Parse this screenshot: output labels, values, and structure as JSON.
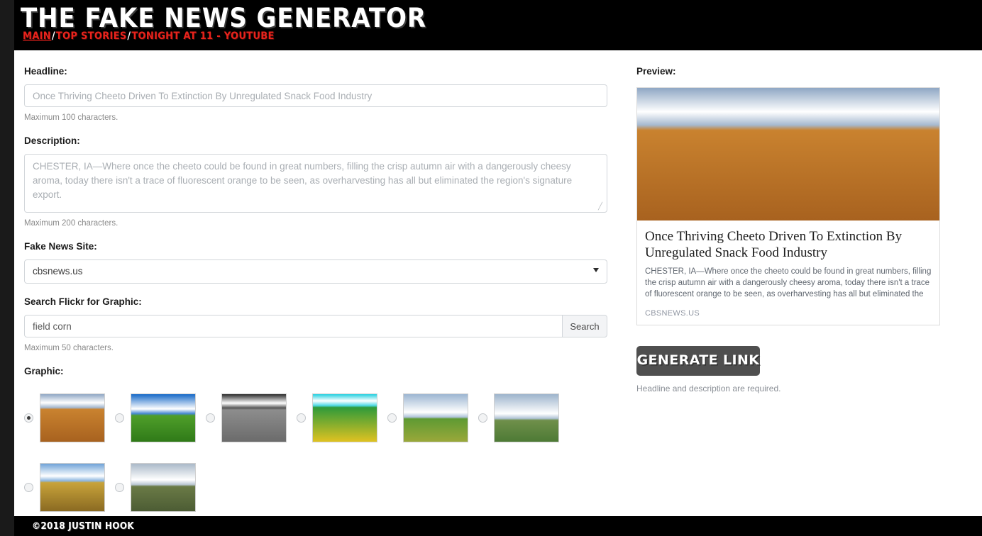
{
  "header": {
    "title": "THE FAKE NEWS GENERATOR",
    "nav": [
      {
        "label": "MAIN",
        "active": true
      },
      {
        "label": "TOP STORIES",
        "active": false
      },
      {
        "label": "TONIGHT AT 11 - YOUTUBE",
        "active": false
      }
    ],
    "separator": "/"
  },
  "form": {
    "headline": {
      "label": "Headline:",
      "value": "",
      "placeholder": "Once Thriving Cheeto Driven To Extinction By Unregulated Snack Food Industry",
      "help": "Maximum 100 characters."
    },
    "description": {
      "label": "Description:",
      "value": "",
      "placeholder": "CHESTER, IA—Where once the cheeto could be found in great numbers, filling the crisp autumn air with a dangerously cheesy aroma, today there isn't a trace of fluorescent orange to be seen, as overharvesting has all but eliminated the region's signature export.",
      "help": "Maximum 200 characters."
    },
    "site": {
      "label": "Fake News Site:",
      "selected": "cbsnews.us",
      "options": [
        "cbsnews.us"
      ]
    },
    "flickr": {
      "label": "Search Flickr for Graphic:",
      "value": "field corn",
      "placeholder": "",
      "button_label": "Search",
      "help": "Maximum 50 characters."
    },
    "graphic": {
      "label": "Graphic:",
      "selected_index": 0,
      "thumbnails": [
        {
          "name": "golden-wheat-field",
          "sky": "#8fa7c4",
          "ground": "#c9822f",
          "ground2": "#a8621f",
          "horizon": 32
        },
        {
          "name": "green-corn-blue-sky",
          "sky": "#1669c8",
          "ground": "#4f9e2a",
          "ground2": "#2f7a18",
          "horizon": 45
        },
        {
          "name": "black-and-white-cornfield",
          "sky": "#2a2a2a",
          "ground": "#8d8d8d",
          "ground2": "#6b6b6b",
          "horizon": 33
        },
        {
          "name": "painted-field-artwork",
          "sky": "#21cfe0",
          "ground": "#2f9a3a",
          "ground2": "#e0c221",
          "horizon": 28
        },
        {
          "name": "cloudy-sky-over-corn",
          "sky": "#9cb6d2",
          "ground": "#5f9a33",
          "ground2": "#9aa83a",
          "horizon": 52
        },
        {
          "name": "distant-treeline-field",
          "sky": "#9db4cc",
          "ground": "#6f8f4a",
          "ground2": "#4d7a35",
          "horizon": 55
        },
        {
          "name": "corn-stalks-against-sky",
          "sky": "#6fa3d8",
          "ground": "#c8a33a",
          "ground2": "#8a6a22",
          "horizon": 40
        },
        {
          "name": "open-prairie-grassland",
          "sky": "#aab9c9",
          "ground": "#6a7a46",
          "ground2": "#4c5c34",
          "horizon": 48
        }
      ]
    }
  },
  "preview": {
    "label": "Preview:",
    "card": {
      "image_name": "golden-wheat-field",
      "title": "Once Thriving Cheeto Driven To Extinction By Unregulated Snack Food Industry",
      "description": "CHESTER, IA—Where once the cheeto could be found in great numbers, filling the crisp autumn air with a dangerously cheesy aroma, today there isn't a trace of fluorescent orange to be seen, as overharvesting has all but eliminated the region's",
      "source": "CBSNEWS.US"
    },
    "generate_button": "GENERATE LINK",
    "generate_note": "Headline and description are required."
  },
  "footer": {
    "copyright": "©2018 JUSTIN HOOK"
  },
  "colors": {
    "header_bg": "#000000",
    "nav_link": "#e8231c",
    "page_bg": "#1a1a1a",
    "content_bg": "#ffffff",
    "button_bg": "#4f4f4f"
  }
}
